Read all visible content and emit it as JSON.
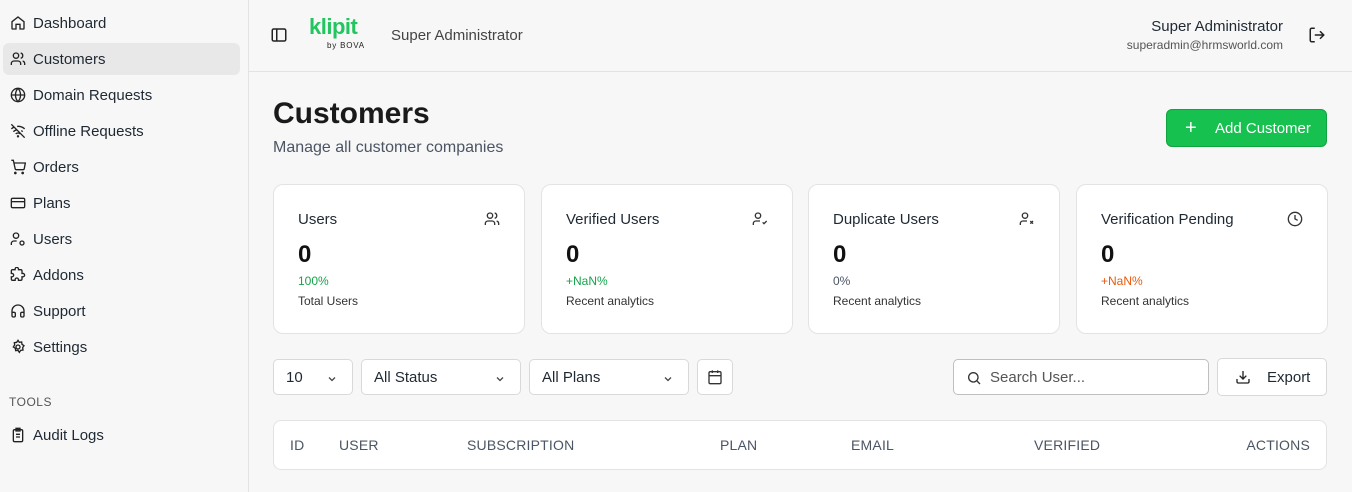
{
  "sidebar": {
    "items": [
      {
        "label": "Dashboard",
        "icon": "home-icon"
      },
      {
        "label": "Customers",
        "icon": "users-icon"
      },
      {
        "label": "Domain Requests",
        "icon": "globe-icon"
      },
      {
        "label": "Offline Requests",
        "icon": "wifi-off-icon"
      },
      {
        "label": "Orders",
        "icon": "cart-icon"
      },
      {
        "label": "Plans",
        "icon": "credit-card-icon"
      },
      {
        "label": "Users",
        "icon": "user-cog-icon"
      },
      {
        "label": "Addons",
        "icon": "puzzle-icon"
      },
      {
        "label": "Support",
        "icon": "headphones-icon"
      },
      {
        "label": "Settings",
        "icon": "gear-icon"
      }
    ],
    "tools_label": "TOOLS",
    "tools_items": [
      {
        "label": "Audit Logs",
        "icon": "clipboard-icon"
      }
    ],
    "active": "Customers"
  },
  "header": {
    "logo_text": "klipit",
    "logo_sub": "by BOVA",
    "role": "Super Administrator",
    "user_name": "Super Administrator",
    "user_email": "superadmin@hrmsworld.com"
  },
  "main": {
    "title": "Customers",
    "subtitle": "Manage all customer companies",
    "add_button": "Add Customer",
    "cards": [
      {
        "title": "Users",
        "value": "0",
        "delta": "100%",
        "delta_color": "#16a34a",
        "foot": "Total Users",
        "icon": "users-icon"
      },
      {
        "title": "Verified Users",
        "value": "0",
        "delta": "+NaN%",
        "delta_color": "#16a34a",
        "foot": "Recent analytics",
        "icon": "user-check-icon"
      },
      {
        "title": "Duplicate Users",
        "value": "0",
        "delta": "0%",
        "delta_color": "#4b5563",
        "foot": "Recent analytics",
        "icon": "user-x-icon"
      },
      {
        "title": "Verification Pending",
        "value": "0",
        "delta": "+NaN%",
        "delta_color": "#ea580c",
        "foot": "Recent analytics",
        "icon": "clock-icon"
      }
    ],
    "filters": {
      "page_size": "10",
      "status": "All Status",
      "plans": "All Plans",
      "search_placeholder": "Search User...",
      "export_label": "Export"
    },
    "table": {
      "columns": [
        "ID",
        "USER",
        "SUBSCRIPTION",
        "PLAN",
        "EMAIL",
        "VERIFIED",
        "ACTIONS"
      ]
    }
  },
  "colors": {
    "accent": "#16c14f",
    "positive": "#16a34a",
    "warning": "#ea580c"
  }
}
